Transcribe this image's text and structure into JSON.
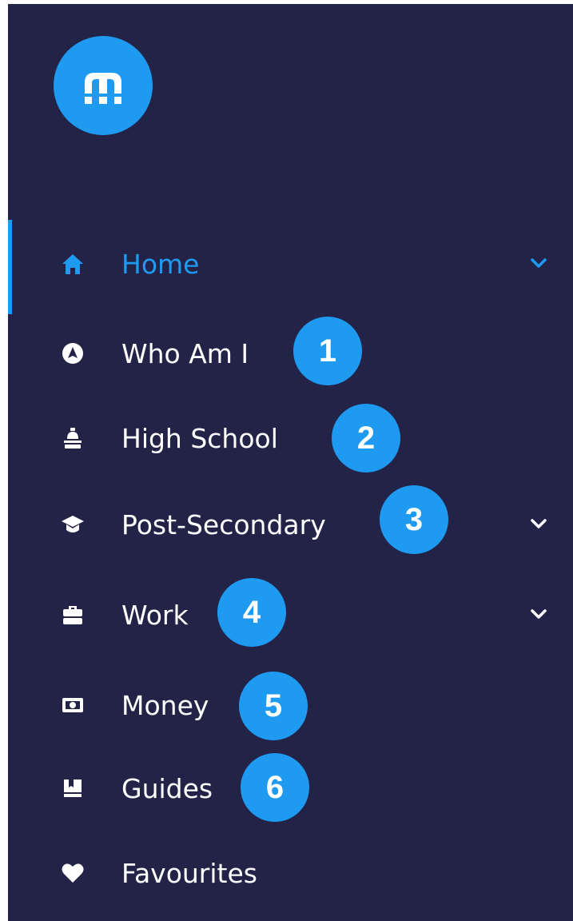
{
  "brand": {
    "logo_icon": "m-logo-icon",
    "accent_color": "#1e9bf0",
    "sidebar_bg": "#232348"
  },
  "nav": {
    "items": [
      {
        "label": "Home",
        "icon": "home-icon",
        "active": true,
        "expandable": true
      },
      {
        "label": "Who Am I",
        "icon": "compass-icon",
        "active": false,
        "expandable": false
      },
      {
        "label": "High School",
        "icon": "school-bag-icon",
        "active": false,
        "expandable": false
      },
      {
        "label": "Post-Secondary",
        "icon": "graduation-cap-icon",
        "active": false,
        "expandable": true
      },
      {
        "label": "Work",
        "icon": "briefcase-icon",
        "active": false,
        "expandable": true
      },
      {
        "label": "Money",
        "icon": "money-icon",
        "active": false,
        "expandable": false
      },
      {
        "label": "Guides",
        "icon": "book-icon",
        "active": false,
        "expandable": false
      },
      {
        "label": "Favourites",
        "icon": "heart-icon",
        "active": false,
        "expandable": false
      }
    ]
  },
  "callouts": [
    "1",
    "2",
    "3",
    "4",
    "5",
    "6"
  ]
}
